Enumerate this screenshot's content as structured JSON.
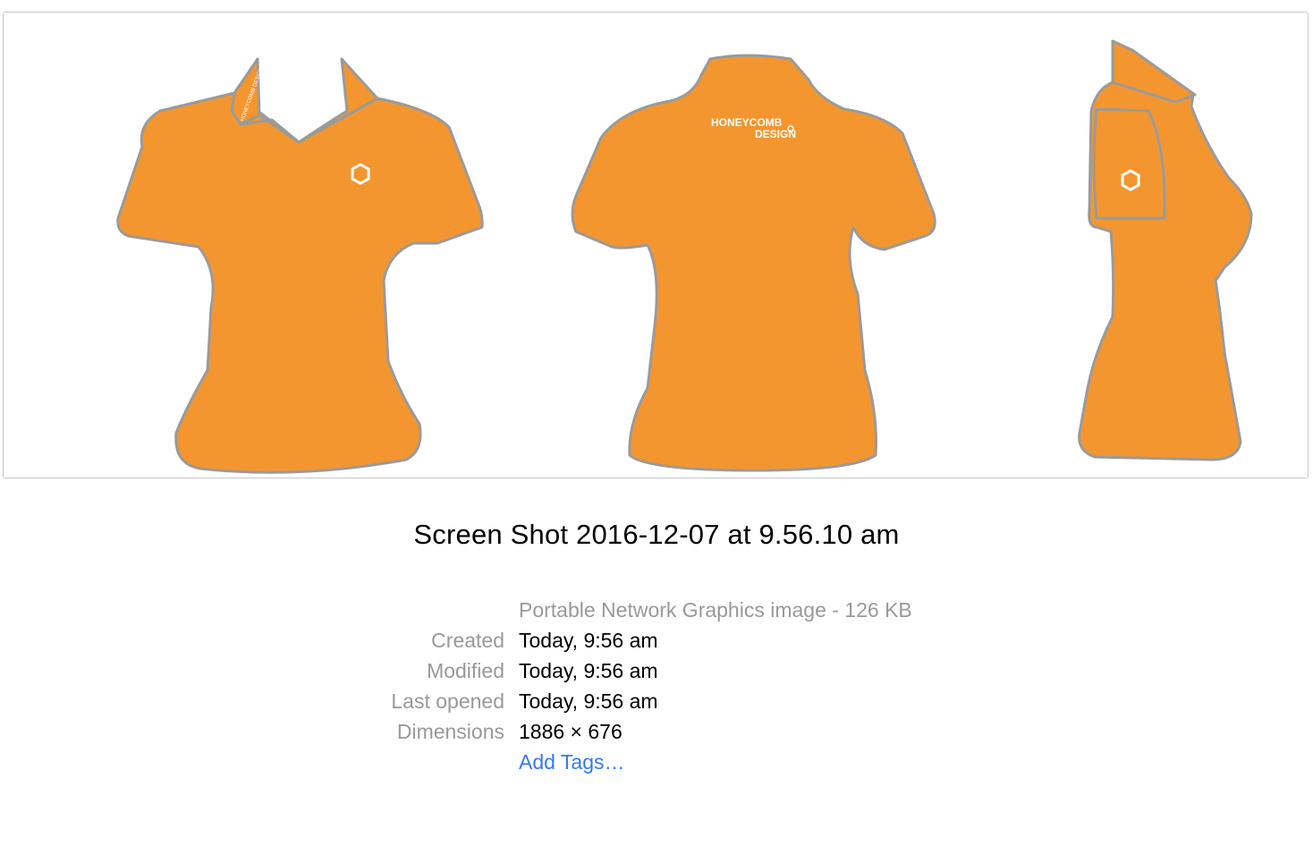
{
  "preview": {
    "garment_color": "#f4962f",
    "outline_color": "#9a9a9a",
    "logo_line1": "HONEYCOMB",
    "logo_line2": "DESIGN",
    "collar_text": "HONEYCOMB DESIGN"
  },
  "file": {
    "name": "Screen Shot 2016-12-07 at 9.56.10 am",
    "kind": "Portable Network Graphics image - 126 KB"
  },
  "info": [
    {
      "label": "Created",
      "value": "Today, 9:56 am"
    },
    {
      "label": "Modified",
      "value": "Today, 9:56 am"
    },
    {
      "label": "Last opened",
      "value": "Today, 9:56 am"
    },
    {
      "label": "Dimensions",
      "value": "1886 × 676"
    }
  ],
  "add_tags": "Add Tags…",
  "colors": {
    "label": "#999999",
    "link": "#3478f6"
  }
}
